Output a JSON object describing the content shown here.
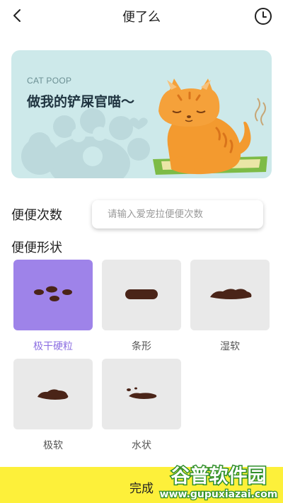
{
  "header": {
    "title": "便了么",
    "back_icon": "chevron-left-icon",
    "history_icon": "clock-icon"
  },
  "banner": {
    "subtitle": "CAT POOP",
    "title": "做我的铲屎官喵～",
    "bg_color": "#cde9ea",
    "illustration": "orange-cat-in-litter-box"
  },
  "count": {
    "label": "便便次数",
    "placeholder": "请输入爱宠拉便便次数",
    "value": ""
  },
  "shape": {
    "label": "便便形状",
    "options": [
      {
        "label": "极干硬粒",
        "selected": true
      },
      {
        "label": "条形",
        "selected": false
      },
      {
        "label": "湿软",
        "selected": false
      },
      {
        "label": "极软",
        "selected": false
      },
      {
        "label": "水状",
        "selected": false
      }
    ],
    "selected_color": "#9e83e9",
    "tile_color": "#e9e9e9"
  },
  "footer": {
    "done_label": "完成",
    "bar_color": "#fdf03a"
  },
  "watermark": {
    "text": "谷普软件园",
    "url": "www.gupuxiazai.com"
  }
}
